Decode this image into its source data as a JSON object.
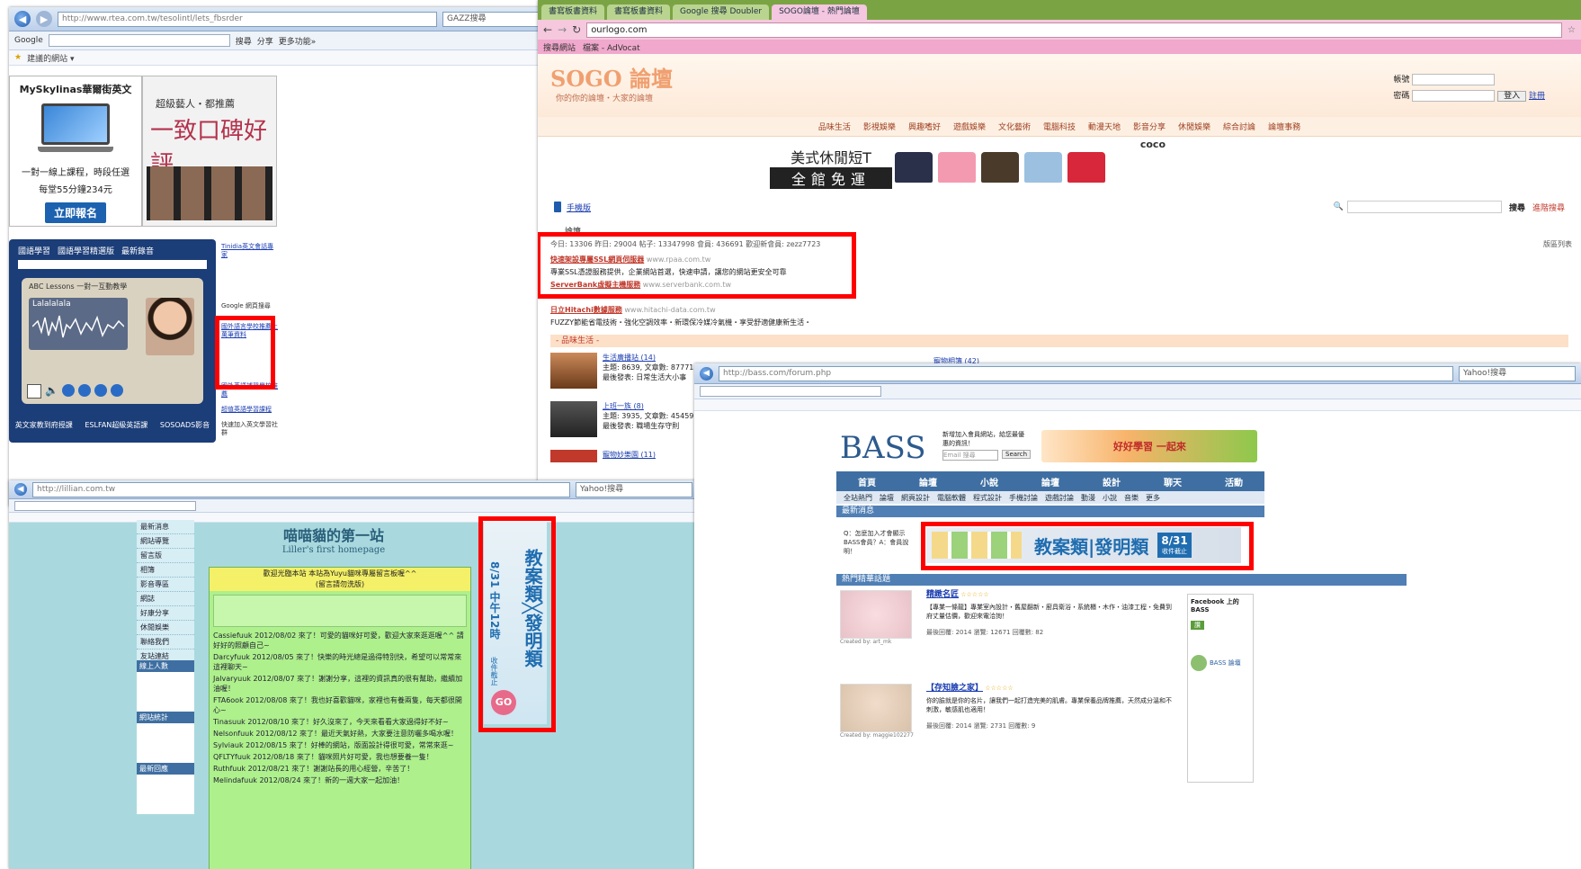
{
  "win1": {
    "address": "http://www.rtea.com.tw/tesolintl/lets_fbsrder",
    "search": "GAZZ搜尋",
    "toolbar_google": "Google",
    "toolbar_search": "搜尋",
    "toolbar_share": "分享",
    "toolbar_more": "更多功能»",
    "fav": "建議的網站 ▾",
    "ad1_title": "MySkylinas華爾街英文",
    "ad1_text": "一對一線上課程，時段任選",
    "ad1_price": "每堂55分鐘234元",
    "ad1_cta": "立即報名",
    "ad2_line1": "超級藝人・都推薦",
    "ad2_line2": "一致口碑好評",
    "player_tabs": [
      "國語學習",
      "國語學習精選版",
      "最新錄音"
    ],
    "player_banner": "Lalalalala",
    "player_caption": "ABC Lessons 一對一互動教學",
    "player_footer": [
      "英文家教到府授課",
      "ESLFAN超級英語課",
      "SOSOADS影音"
    ],
    "side_links": [
      "Tinidia英文會話專家",
      "Google 網頁搜尋",
      "國外英語補習學校推薦",
      "超值英語學習課程",
      "快速加入英文學習社群"
    ],
    "highlight_text": "國外語言學校推薦上萬筆資料"
  },
  "win2": {
    "tabs": [
      "書寫板書資料",
      "書寫板書資料",
      "Google 搜尋 Doubler",
      "SOGO論壇 - 熱門論壇"
    ],
    "url": "ourlogo.com",
    "bookmarks": [
      "搜尋網站",
      "檔案 - AdVocat"
    ],
    "logo": "SOGO 論壇",
    "slogan": "你的你的論壇・大家的論壇",
    "login_account_label": "帳號",
    "login_password_label": "密碼",
    "login_button": "登入",
    "register_link": "註冊",
    "nav": [
      "品味生活",
      "影視娛樂",
      "興趣嗜好",
      "遊戲娛樂",
      "文化藝術",
      "電腦科技",
      "動漫天地",
      "影音分享",
      "休閒娛樂",
      "綜合討論",
      "論壇事務"
    ],
    "banner_line1": "美式休閒短T",
    "banner_line2": "全館免運",
    "banner_brand": "coco",
    "mobile_label": "手機版",
    "search_placeholder": "請輸入搜尋內容",
    "search_button": "搜尋",
    "search_extra": "進階搜尋",
    "breadcrumb": "論壇",
    "stats": "今日: 13306  昨日: 29004  帖子: 13347998  會員: 436691  歡迎新會員: zezz7723",
    "stats_right": "版區列表",
    "ad1_title": "快速架設專屬SSL網頁伺服器",
    "ad1_url": "www.rpaa.com.tw",
    "ad1_text": "專業SSL憑證服務提供，企業網站首選，快速申請，讓您的網站更安全可靠",
    "ad2_title": "ServerBank虛擬主機服務",
    "ad2_url": "www.serverbank.com.tw",
    "ad3_title": "日立Hitachi數據服務",
    "ad3_url": "www.hitachi-data.com.tw",
    "ad3_text": "FUZZY節能省電技術・強化空調效率・新環保冷媒冷氣機・享受舒適健康新生活・",
    "section": "- 品味生活 -",
    "threads": [
      {
        "title": "生活廣播站 (14)",
        "meta": "主題: 8639, 文章數: 87771",
        "last": "最後發表: 日常生活大小事"
      },
      {
        "title": "上班一族 (8)",
        "meta": "主題: 3935, 文章數: 45459",
        "last": "最後發表: 職場生存守則"
      },
      {
        "title": "寵物妙樂園 (11)",
        "meta": "",
        "last": ""
      }
    ],
    "right_thread": "寵物相簿 (42)"
  },
  "win3": {
    "address": "http://lillian.com.tw",
    "search": "Yahoo!搜尋",
    "header1": "喵喵貓的第一站",
    "header2": "Liller's first homepage",
    "board_title": "歡迎光臨本站 本站為Yuyu貓咪專屬留言板喔^^",
    "board_subtitle": "(留言請勿洗版)",
    "menu": [
      "最新消息",
      "網站導覽",
      "留言版",
      "相簿",
      "影音專區",
      "網誌",
      "好康分享",
      "休閒娛樂",
      "聯絡我們",
      "友站連結"
    ],
    "menu_groups": [
      "線上人數",
      "網站統計",
      "最新回應"
    ],
    "posts": [
      "Cassiefuuk 2012/08/02 來了！可愛的貓咪好可愛，歡迎大家來逛逛喔^^ 請好好的照顧自己~",
      "Darcyfuuk 2012/08/05 來了！快樂的時光總是過得特別快，希望可以常常來這裡聊天~",
      "Jalvaryuuk 2012/08/07 來了！謝謝分享，這裡的資訊真的很有幫助，繼續加油喔！",
      "FTA6ook 2012/08/08 來了！我也好喜歡貓咪，家裡也有養兩隻，每天都很開心~",
      "Tinasuuk 2012/08/10 來了！好久沒來了，今天來看看大家過得好不好~",
      "Nelsonfuuk 2012/08/12 來了！最近天氣好熱，大家要注意防曬多喝水喔！",
      "Sylviauk 2012/08/15 來了！好棒的網站，版面設計得很可愛，常常來逛~",
      "QFLTYfuuk 2012/08/18 來了！貓咪照片好可愛，我也想要養一隻！",
      "Ruthfuuk 2012/08/21 來了！謝謝站長的用心經營，辛苦了！",
      "Melindafuuk 2012/08/24 來了！新的一週大家一起加油！"
    ],
    "ad_vertical_main": "教案類╳發明類",
    "ad_vertical_date": "8/31 中午12時",
    "ad_vertical_sub": "收件截止",
    "ad_go": "GO"
  },
  "win4": {
    "address": "http://bass.com/forum.php",
    "search": "Yahoo!搜尋",
    "logo": "BASS",
    "promo_text": "新增加入會員網站，給您最優惠的資訊！",
    "promo_input": "Email 搜尋",
    "promo_button": "Search",
    "banner_text": "好好學習 一起來",
    "nav": [
      "首頁",
      "論壇",
      "小說",
      "論壇",
      "設計",
      "聊天",
      "活動"
    ],
    "subnav": [
      "全站熱門",
      "論壇",
      "網頁設計",
      "電腦軟體",
      "程式設計",
      "手機討論",
      "遊戲討論",
      "動漫",
      "小說",
      "音樂",
      "更多"
    ],
    "section_title": "最新消息",
    "sidebar_note": "Q：怎麼加入才會顯示BASS會員？A：會員說明！",
    "ad_main": "教案類|發明類",
    "ad_date": "8/31",
    "ad_sub": "收件截止",
    "hot_title": "熱門精華話題",
    "posts": [
      {
        "title": "精緻名匠",
        "stars": "☆☆☆☆☆",
        "text": "【專業一條龍】專業室內設計・舊屋翻新・廚具衛浴・系統櫃・木作・油漆工程・免費到府丈量估價，歡迎來電洽詢！",
        "by": "Created by: art_mk",
        "meta": "最後回覆: 2014  瀏覽: 12671  回覆數: 82"
      },
      {
        "title": "【存知臉之家】",
        "stars": "☆☆☆☆☆",
        "text": "你的臉就是你的名片，讓我們一起打造完美的肌膚。專業保養品牌推薦，天然成分溫和不刺激，敏感肌也適用！",
        "by": "Created by: maggie102277",
        "meta": "最後回覆: 2014  瀏覽: 2731  回覆數: 9"
      }
    ],
    "facebook_title": "Facebook 上的BASS",
    "fb_like": "讚",
    "fb_member": "BASS 論壇"
  },
  "colors": {
    "highlight": "#ff0000",
    "ie_chrome": "#bcd0ea",
    "sogo_pink": "#f5c8de",
    "bass_blue": "#3f6fa2",
    "green_board": "#aef08c",
    "teal_bg": "#a9d9de"
  }
}
